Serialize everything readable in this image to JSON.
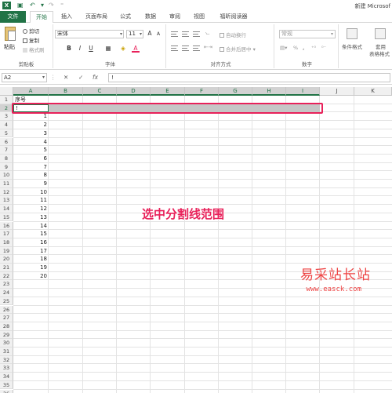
{
  "window": {
    "logo": "X",
    "title": "新建 Microsof"
  },
  "tabs": [
    "文件",
    "开始",
    "插入",
    "页面布局",
    "公式",
    "数据",
    "审阅",
    "视图",
    "福昕阅读器"
  ],
  "ribbon": {
    "clipboard": {
      "paste": "粘贴",
      "cut": "剪切",
      "copy": "复制",
      "format_painter": "格式刷",
      "label": "剪贴板"
    },
    "font": {
      "name": "宋体",
      "size": "11",
      "bold": "B",
      "italic": "I",
      "underline": "U",
      "grow": "A",
      "shrink": "A",
      "color_glyph": "A",
      "label": "字体",
      "accent_color": "#e8215a"
    },
    "alignment": {
      "wrap": "自动换行",
      "merge": "合并后居中",
      "label": "对齐方式"
    },
    "number": {
      "format": "常规",
      "percent": "%",
      "comma": ",",
      "label": "数字"
    },
    "styles": {
      "conditional": "条件格式",
      "table_line1": "套用",
      "table_line2": "表格格式"
    }
  },
  "formula_bar": {
    "name_box": "A2",
    "cancel": "✕",
    "enter": "✓",
    "fx": "fx",
    "content": "!"
  },
  "grid": {
    "columns": [
      "A",
      "B",
      "C",
      "D",
      "E",
      "F",
      "G",
      "H",
      "I",
      "J",
      "K"
    ],
    "header_text": "序号",
    "active_cell_text": "!",
    "values": [
      "1",
      "2",
      "3",
      "4",
      "5",
      "6",
      "7",
      "8",
      "9",
      "10",
      "11",
      "12",
      "13",
      "14",
      "15",
      "16",
      "17",
      "18",
      "19",
      "20"
    ]
  },
  "annotation": "选中分割线范围",
  "watermark": {
    "title": "易采站长站",
    "url": "www.easck.com"
  },
  "colors": {
    "brand": "#217346",
    "highlight": "#e8215a",
    "watermark": "#e44"
  }
}
